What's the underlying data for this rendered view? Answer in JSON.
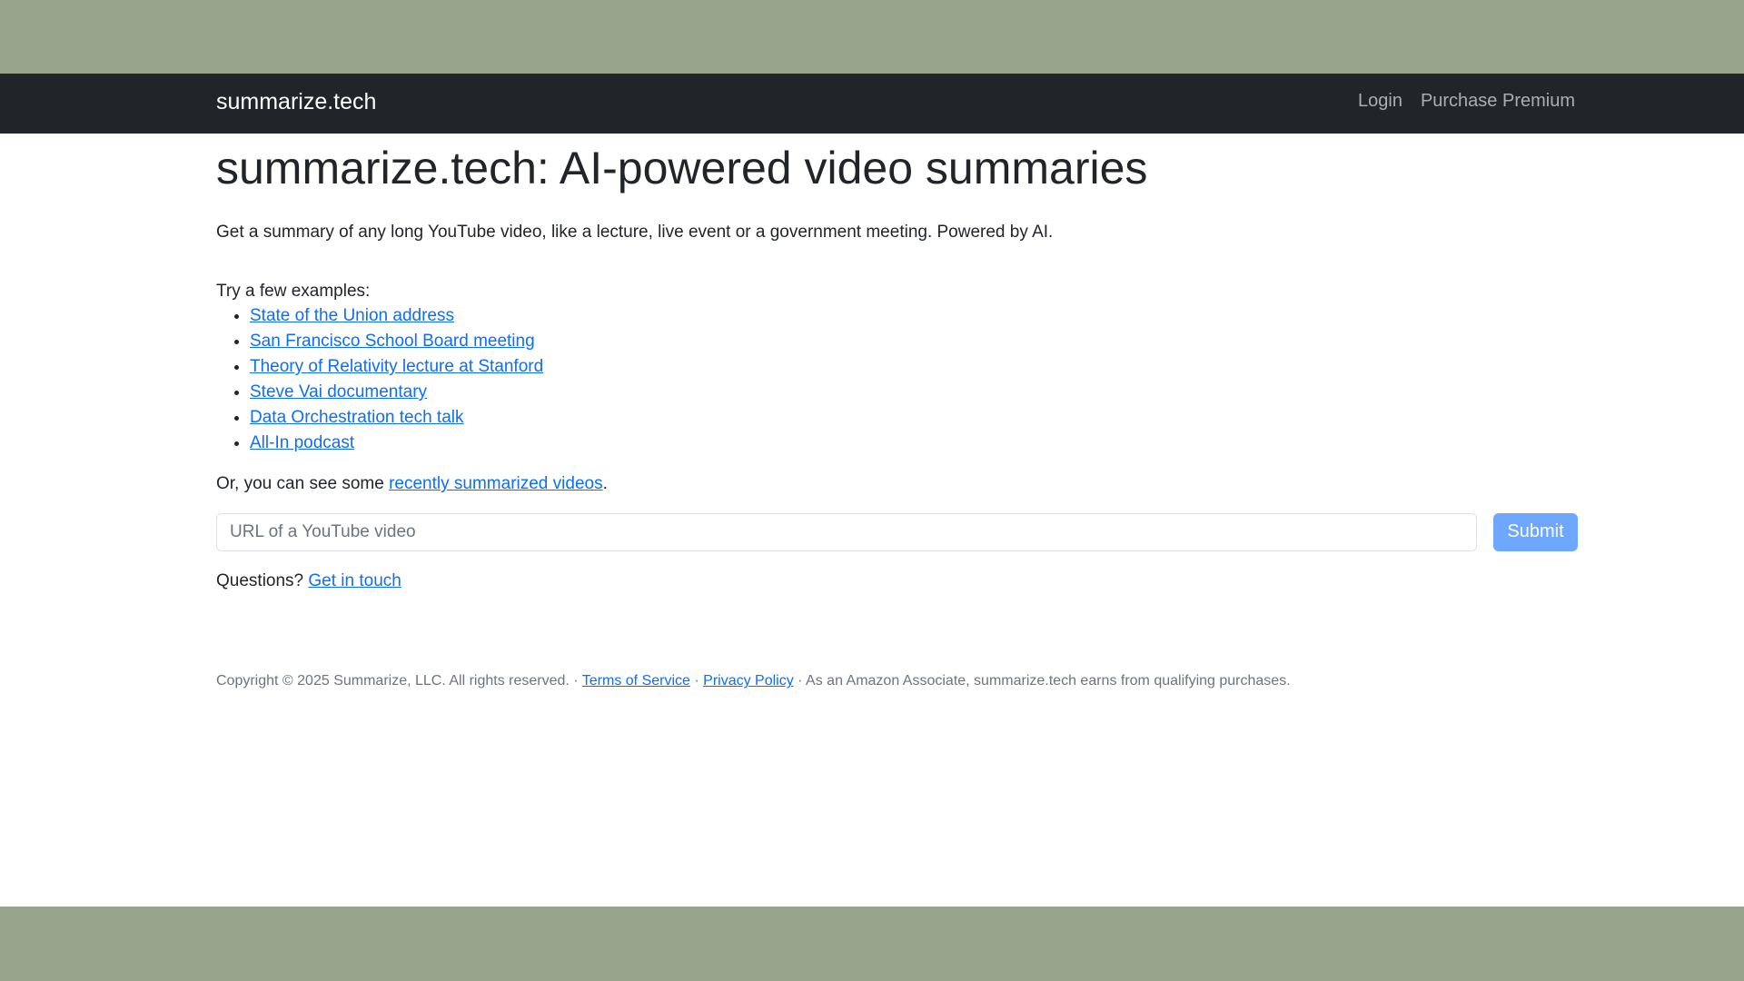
{
  "navbar": {
    "brand": "summarize.tech",
    "links": [
      "Login",
      "Purchase Premium"
    ]
  },
  "main": {
    "title": "summarize.tech: AI-powered video summaries",
    "lead": "Get a summary of any long YouTube video, like a lecture, live event or a government meeting. Powered by AI.",
    "examples_intro": "Try a few examples:",
    "examples": [
      "State of the Union address",
      "San Francisco School Board meeting",
      "Theory of Relativity lecture at Stanford",
      "Steve Vai documentary",
      "Data Orchestration tech talk",
      "All-In podcast"
    ],
    "recent_prefix": "Or, you can see some ",
    "recent_link": "recently summarized videos",
    "recent_suffix": ".",
    "url_placeholder": "URL of a YouTube video",
    "submit_label": "Submit",
    "questions_prefix": "Questions? ",
    "questions_link": "Get in touch"
  },
  "footer": {
    "copyright": "Copyright © 2025 Summarize, LLC. All rights reserved. · ",
    "terms": "Terms of Service",
    "sep": " · ",
    "privacy": "Privacy Policy",
    "amazon": " · As an Amazon Associate, summarize.tech earns from qualifying purchases."
  },
  "colors": {
    "outer_background": "#98a58c",
    "navbar_background": "#212529",
    "link": "#0d6efd",
    "submit_button": "#6ea8fe"
  }
}
